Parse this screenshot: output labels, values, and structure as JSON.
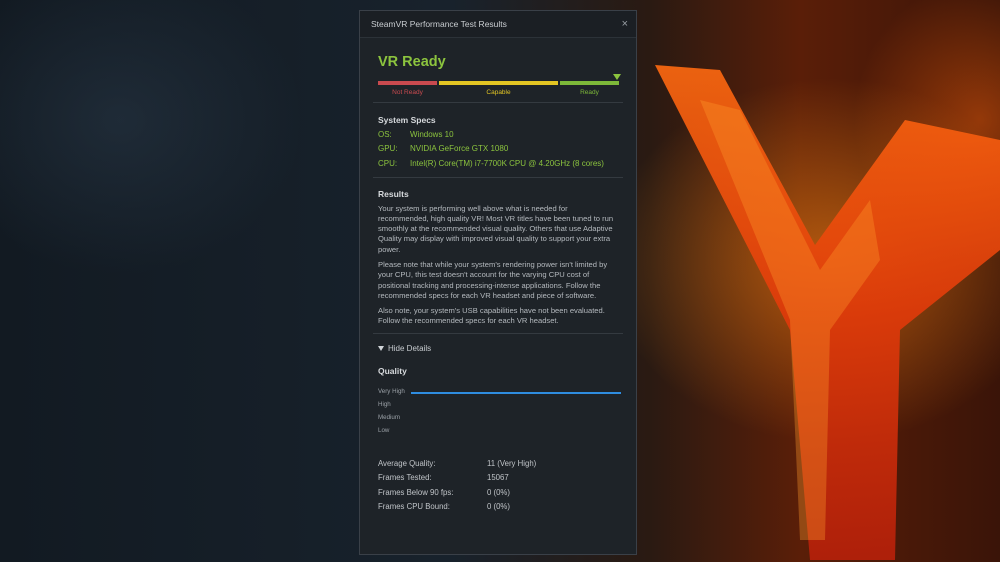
{
  "dialog": {
    "title": "SteamVR Performance Test Results",
    "close_glyph": "×"
  },
  "result": {
    "status": "VR Ready",
    "meter": {
      "labels": [
        "Not Ready",
        "Capable",
        "Ready"
      ],
      "colors": [
        "#c94a4f",
        "#e3c523",
        "#7db839"
      ],
      "selected": "Ready"
    }
  },
  "specs": {
    "title": "System Specs",
    "rows": [
      {
        "key": "OS:",
        "value": "Windows 10"
      },
      {
        "key": "GPU:",
        "value": "NVIDIA GeForce GTX 1080"
      },
      {
        "key": "CPU:",
        "value": "Intel(R) Core(TM) i7-7700K CPU @ 4.20GHz (8 cores)"
      }
    ],
    "color": "#8cc43e"
  },
  "results": {
    "title": "Results",
    "paragraphs": [
      "Your system is performing well above what is needed for recommended, high quality VR! Most VR titles have been tuned to run smoothly at the recommended visual quality. Others that use Adaptive Quality may display with improved visual quality to support your extra power.",
      "Please note that while your system's rendering power isn't limited by your CPU, this test doesn't account for the varying CPU cost of positional tracking and processing-intense applications. Follow the recommended specs for each VR headset and piece of software.",
      "Also note, your system's USB capabilities have not been evaluated. Follow the recommended specs for each VR headset."
    ]
  },
  "details": {
    "toggle_label": "Hide Details",
    "quality_title": "Quality",
    "quality_levels": [
      "Very High",
      "High",
      "Medium",
      "Low"
    ],
    "line_color": "#2f8de0",
    "stats": [
      {
        "key": "Average Quality:",
        "value": "11 (Very High)"
      },
      {
        "key": "Frames Tested:",
        "value": "15067"
      },
      {
        "key": "Frames Below 90 fps:",
        "value": "0 (0%)"
      },
      {
        "key": "Frames CPU Bound:",
        "value": "0 (0%)"
      }
    ]
  },
  "chart_data": {
    "type": "line",
    "y_categories": [
      "Very High",
      "High",
      "Medium",
      "Low"
    ],
    "series": [
      {
        "values": [
          "Very High"
        ]
      }
    ]
  }
}
